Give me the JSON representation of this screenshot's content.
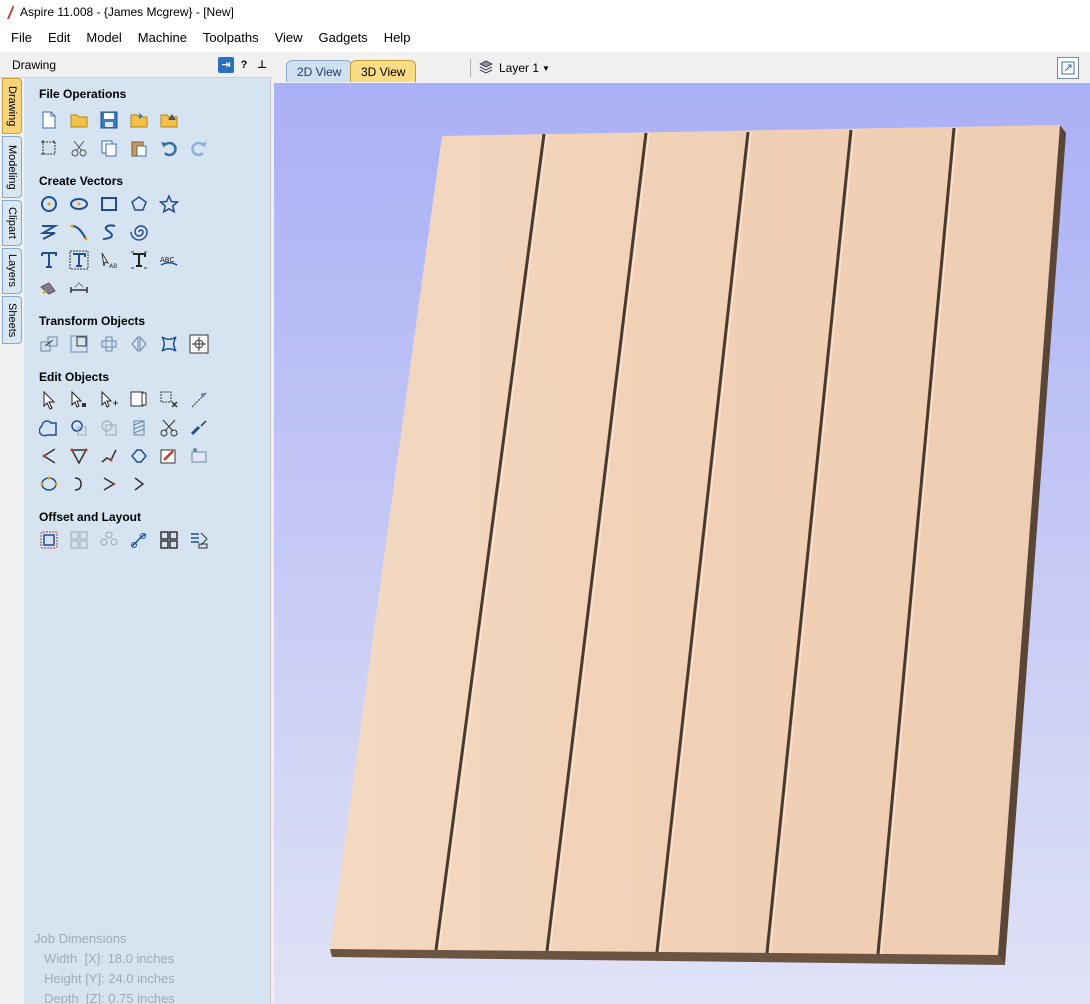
{
  "window": {
    "title": "Aspire 11.008 - {James Mcgrew} - [New]"
  },
  "menu": [
    "File",
    "Edit",
    "Model",
    "Machine",
    "Toolpaths",
    "View",
    "Gadgets",
    "Help"
  ],
  "panel": {
    "title": "Drawing",
    "help_label": "?",
    "vertical_tabs": [
      "Drawing",
      "Modeling",
      "Clipart",
      "Layers",
      "Sheets"
    ],
    "sections": [
      {
        "title": "File Operations"
      },
      {
        "title": "Create Vectors"
      },
      {
        "title": "Transform Objects"
      },
      {
        "title": "Edit Objects"
      },
      {
        "title": "Offset and Layout"
      }
    ],
    "job_dimensions": {
      "heading": "Job Dimensions",
      "width": "Width  [X]: 18.0 inches",
      "height": "Height [Y]: 24.0 inches",
      "depth": "Depth  [Z]: 0.75 inches"
    }
  },
  "view_tabs": {
    "tab_2d": "2D View",
    "tab_3d": "3D View",
    "active": "3D View"
  },
  "layer": {
    "label": "Layer 1"
  },
  "colors": {
    "panel_bg": "#d6e4f2",
    "active_tab": "#f9dc84",
    "viewport_top": "#aab0f5",
    "viewport_bottom": "#e0e2f5",
    "wood": "#f1d2b8"
  }
}
